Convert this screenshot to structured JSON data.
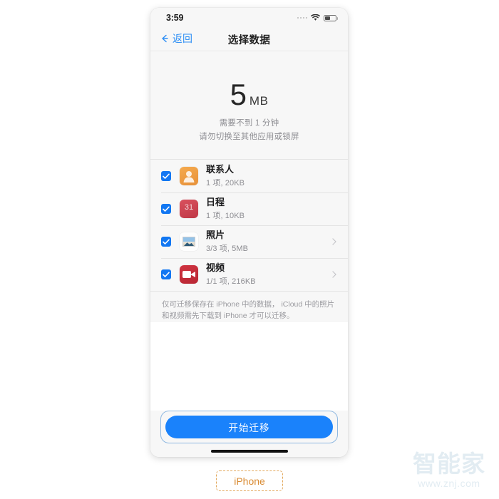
{
  "status_bar": {
    "time": "3:59",
    "signal_icon": "signal-dots-icon",
    "wifi_icon": "wifi-icon",
    "battery_icon": "battery-icon",
    "battery_level": 45
  },
  "nav": {
    "back_label": "返回",
    "back_icon": "chevron-left-icon",
    "title": "选择数据"
  },
  "summary": {
    "size_value": "5",
    "size_unit": "MB",
    "line1": "需要不到 1 分钟",
    "line2": "请勿切换至其他应用或锁屏"
  },
  "list": {
    "rows": [
      {
        "title": "联系人",
        "subtitle": "1 项, 20KB",
        "icon": "contacts-icon",
        "checked": true,
        "has_chevron": false
      },
      {
        "title": "日程",
        "subtitle": "1 项, 10KB",
        "icon": "calendar-icon",
        "icon_text": "31",
        "checked": true,
        "has_chevron": false
      },
      {
        "title": "照片",
        "subtitle": "3/3 项, 5MB",
        "icon": "photos-icon",
        "checked": true,
        "has_chevron": true
      },
      {
        "title": "视频",
        "subtitle": "1/1 项, 216KB",
        "icon": "video-icon",
        "checked": true,
        "has_chevron": true
      }
    ]
  },
  "footnote": {
    "text": "仅可迁移保存在 iPhone 中的数据， iCloud 中的照片和视频需先下载到 iPhone 才可以迁移。"
  },
  "action": {
    "start_label": "开始迁移"
  },
  "caption": {
    "device_label": "iPhone"
  },
  "watermark": {
    "logo": "智能家",
    "url": "www.znj.com"
  },
  "colors": {
    "accent_blue": "#1a82fb",
    "link_blue": "#2f8ff5",
    "checkbox_blue": "#1277f2",
    "screen_bg": "#f7f7f7",
    "caption_orange": "#d98b33",
    "watermark": "#e2ecf2"
  }
}
